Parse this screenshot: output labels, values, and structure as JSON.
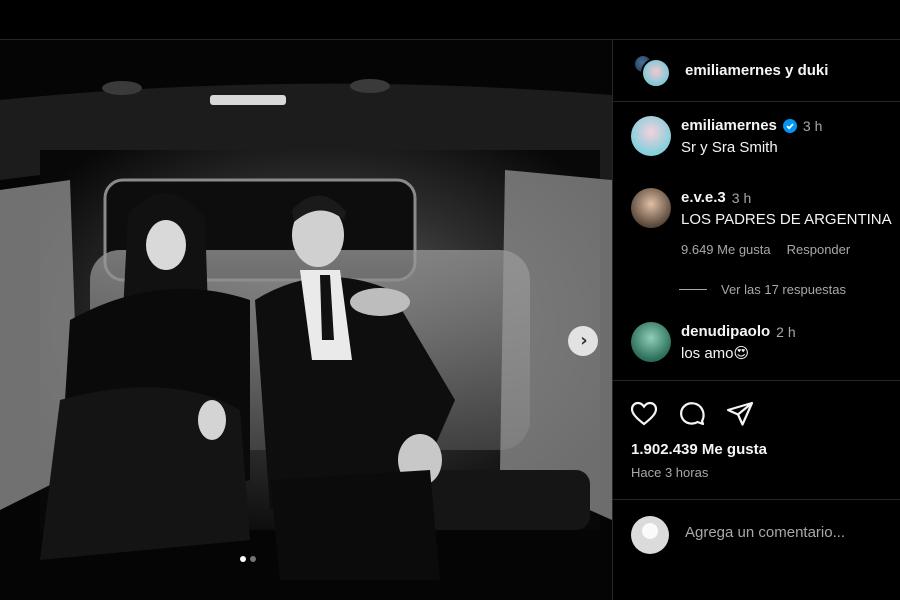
{
  "header": {
    "title": "emiliamernes y duki"
  },
  "post": {
    "caption": {
      "user": "emiliamernes",
      "time": "3 h",
      "text": "Sr y Sra Smith"
    },
    "comments": [
      {
        "user": "e.v.e.3",
        "time": "3 h",
        "text": "LOS PADRES DE ARGENTINA",
        "likes": "9.649 Me gusta",
        "reply_label": "Responder"
      },
      {
        "user": "denudipaolo",
        "time": "2 h",
        "text": "los amo😍"
      }
    ],
    "view_replies": "Ver las 17 respuestas",
    "likes": "1.902.439 Me gusta",
    "posted": "Hace 3 horas",
    "comment_placeholder": "Agrega un comentario..."
  },
  "media": {
    "next_glyph": "›",
    "carousel": {
      "count": 2,
      "active": 0
    }
  },
  "icons": {
    "like": "heart-icon",
    "comment": "comment-icon",
    "share": "send-icon",
    "verified": "verified-badge-icon",
    "next": "chevron-right-icon"
  },
  "colors": {
    "background": "#000000",
    "text": "#f5f5f5",
    "muted": "#a8a8a8",
    "verified": "#0095f6",
    "divider": "#262626"
  }
}
